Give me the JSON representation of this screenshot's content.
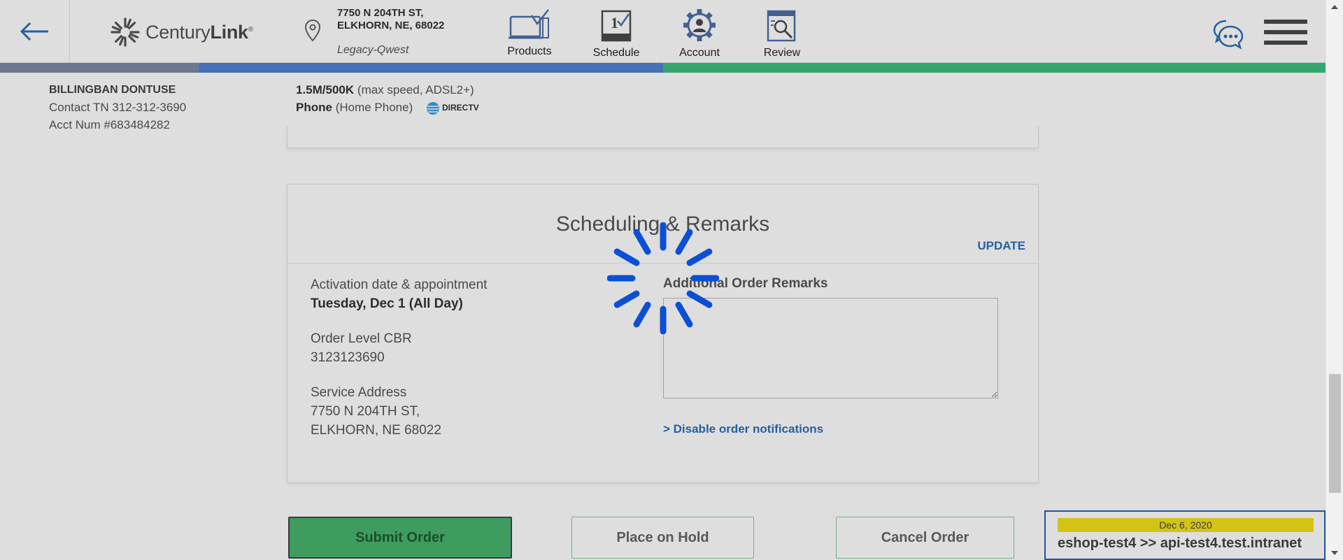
{
  "header": {
    "brand": {
      "name_light": "Century",
      "name_bold": "Link",
      "mark": "®"
    },
    "address": {
      "line1": "7750 N 204TH ST,",
      "line2": "ELKHORN, NE, 68022",
      "region": "Legacy-Qwest"
    },
    "nav": [
      {
        "label": "Products",
        "icon": "products-icon"
      },
      {
        "label": "Schedule",
        "icon": "schedule-icon",
        "calendar_day": "1"
      },
      {
        "label": "Account",
        "icon": "account-icon"
      },
      {
        "label": "Review",
        "icon": "review-icon"
      }
    ]
  },
  "progress": {
    "colors": [
      "#7d8aa5",
      "#4f82d4",
      "#3fbf7f"
    ]
  },
  "customer": {
    "name": "BILLINGBAN DONTUSE",
    "contact": "Contact TN 312-312-3690",
    "account": "Acct Num #683484282"
  },
  "services": {
    "internet_speed": "1.5M/500K",
    "internet_detail": "(max speed, ADSL2+)",
    "phone": "Phone",
    "phone_detail": "(Home Phone)",
    "partner": "DIRECTV"
  },
  "scheduling": {
    "title": "Scheduling & Remarks",
    "update_label": "UPDATE",
    "activation_label": "Activation date & appointment",
    "activation_value": "Tuesday, Dec 1 (All Day)",
    "cbr_label": "Order Level CBR",
    "cbr_value": "3123123690",
    "service_address_label": "Service Address",
    "service_address_line1": "7750 N 204TH ST,",
    "service_address_line2": "ELKHORN, NE 68022",
    "remarks_label": "Additional Order Remarks",
    "remarks_value": "",
    "disable_notifications": "> Disable order notifications"
  },
  "actions": {
    "submit": "Submit Order",
    "hold": "Place on Hold",
    "cancel": "Cancel Order"
  },
  "environment": {
    "date": "Dec 6, 2020",
    "host": "eshop-test4 >> api-test4.test.intranet"
  },
  "loading": {
    "visible": true,
    "color": "#0a4fd6"
  }
}
